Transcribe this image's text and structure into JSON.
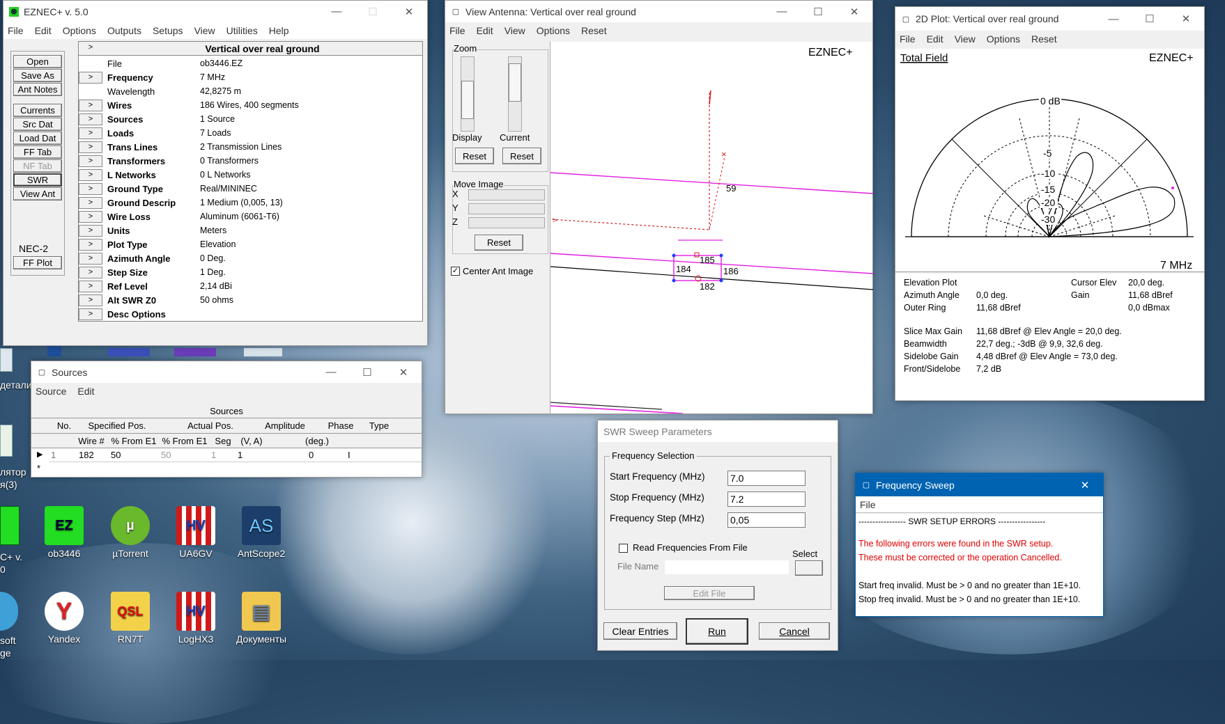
{
  "colors": {
    "magenta": "#e020e0",
    "red": "#d02020",
    "blue": "#1a3fff",
    "title_blue": "#0063b1",
    "error_red": "#e00000"
  },
  "main": {
    "title": "EZNEC+  v. 5.0",
    "menu": [
      "File",
      "Edit",
      "Options",
      "Outputs",
      "Setups",
      "View",
      "Utilities",
      "Help"
    ],
    "buttons": [
      "Open",
      "Save As",
      "Ant Notes",
      "Currents",
      "Src Dat",
      "Load Dat",
      "FF Tab",
      "NF Tab",
      "SWR",
      "View Ant"
    ],
    "nec_label": "NEC-2",
    "ffplot": "FF Plot",
    "arrow": ">",
    "header": "Vertical over real ground",
    "rows": [
      {
        "k": "File",
        "v": "ob3446.EZ",
        "bold": false,
        "arrow": false
      },
      {
        "k": "Frequency",
        "v": "7 MHz",
        "bold": true,
        "arrow": true
      },
      {
        "k": "Wavelength",
        "v": "42,8275 m",
        "bold": false,
        "arrow": false
      },
      {
        "k": "Wires",
        "v": "186 Wires, 400 segments",
        "bold": true,
        "arrow": true
      },
      {
        "k": "Sources",
        "v": "1 Source",
        "bold": true,
        "arrow": true
      },
      {
        "k": "Loads",
        "v": "7 Loads",
        "bold": true,
        "arrow": true
      },
      {
        "k": "Trans Lines",
        "v": "2 Transmission Lines",
        "bold": true,
        "arrow": true
      },
      {
        "k": "Transformers",
        "v": "0 Transformers",
        "bold": true,
        "arrow": true
      },
      {
        "k": "L Networks",
        "v": "0 L Networks",
        "bold": true,
        "arrow": true
      },
      {
        "k": "Ground Type",
        "v": "Real/MININEC",
        "bold": true,
        "arrow": true
      },
      {
        "k": "Ground Descrip",
        "v": "1 Medium (0,005, 13)",
        "bold": true,
        "arrow": true
      },
      {
        "k": "Wire Loss",
        "v": "Aluminum (6061-T6)",
        "bold": true,
        "arrow": true
      },
      {
        "k": "Units",
        "v": "Meters",
        "bold": true,
        "arrow": true
      },
      {
        "k": "Plot Type",
        "v": "Elevation",
        "bold": true,
        "arrow": true
      },
      {
        "k": "Azimuth Angle",
        "v": "0 Deg.",
        "bold": true,
        "arrow": true
      },
      {
        "k": "Step Size",
        "v": "1 Deg.",
        "bold": true,
        "arrow": true
      },
      {
        "k": "Ref Level",
        "v": "2,14 dBi",
        "bold": true,
        "arrow": true
      },
      {
        "k": "Alt SWR Z0",
        "v": "50 ohms",
        "bold": true,
        "arrow": true
      },
      {
        "k": "Desc Options",
        "v": "",
        "bold": true,
        "arrow": true
      }
    ]
  },
  "view": {
    "title": "View Antenna: Vertical over real ground",
    "menu": [
      "File",
      "Edit",
      "View",
      "Options",
      "Reset"
    ],
    "zoom": "Zoom",
    "display": "Display",
    "current": "Current",
    "reset": "Reset",
    "move": "Move Image",
    "x": "X",
    "y": "Y",
    "z": "Z",
    "center": "Center Ant Image",
    "brand": "EZNEC+",
    "labels": {
      "w59": "59",
      "w185": "185",
      "w184": "184",
      "w186": "186",
      "w182": "182"
    }
  },
  "plot": {
    "title": "2D Plot: Vertical over real ground",
    "menu": [
      "File",
      "Edit",
      "View",
      "Options",
      "Reset"
    ],
    "total": "Total Field",
    "brand": "EZNEC+",
    "freq": "7 MHz",
    "rings": [
      "0 dB",
      "-5",
      "-10",
      "-15",
      "-20",
      "-30"
    ],
    "info": [
      [
        "Elevation Plot",
        "",
        "Cursor Elev",
        "20,0 deg."
      ],
      [
        "Azimuth Angle",
        "0,0 deg.",
        "Gain",
        "11,68 dBref"
      ],
      [
        "Outer Ring",
        "11,68 dBref",
        "",
        "0,0 dBmax"
      ]
    ],
    "stats": [
      [
        "Slice Max Gain",
        "11,68 dBref @ Elev Angle = 20,0 deg."
      ],
      [
        "Beamwidth",
        "22,7 deg.; -3dB @ 9,9, 32,6 deg."
      ],
      [
        "Sidelobe Gain",
        "4,48 dBref @ Elev Angle = 73,0 deg."
      ],
      [
        "Front/Sidelobe",
        "7,2 dB"
      ]
    ]
  },
  "sources": {
    "title": "Sources",
    "menu": [
      "Source",
      "Edit"
    ],
    "group": "Sources",
    "h1": [
      "No.",
      "Specified Pos.",
      "Actual Pos.",
      "Amplitude",
      "Phase",
      "Type"
    ],
    "h2": [
      "Wire #",
      "% From E1",
      "% From E1",
      "Seg",
      "(V, A)",
      "(deg.)"
    ],
    "row": [
      "1",
      "182",
      "50",
      "50",
      "1",
      "1",
      "0",
      "I"
    ],
    "star": "*",
    "sel": "▶"
  },
  "swr": {
    "title": "SWR Sweep Parameters",
    "group": "Frequency Selection",
    "start_label": "Start Frequency (MHz)",
    "start": "7.0",
    "stop_label": "Stop Frequency (MHz)",
    "stop": "7.2",
    "step_label": "Frequency Step (MHz)",
    "step": "0,05",
    "read": "Read Frequencies From File",
    "select": "Select",
    "file_name": "File Name",
    "edit_file": "Edit File",
    "clear": "Clear Entries",
    "run": "Run",
    "cancel": "Cancel"
  },
  "freq": {
    "title": "Frequency Sweep",
    "menu": "File",
    "lines": [
      "----------------- SWR SETUP ERRORS -----------------",
      "The following errors were found in the SWR setup.",
      "These must be corrected or the operation Cancelled.",
      "",
      "Start freq invalid. Must be > 0 and no greater than 1E+10.",
      "Stop freq invalid. Must be > 0 and no greater than 1E+10."
    ]
  },
  "desktop": [
    {
      "label": "ob3446",
      "glyph": "EZ",
      "color": "#22dd22"
    },
    {
      "label": "µTorrent",
      "glyph": "µ",
      "color": "#6ab82c"
    },
    {
      "label": "UA6GV",
      "glyph": "HV",
      "color": "#d6d6ff"
    },
    {
      "label": "AntScope2",
      "glyph": "AS",
      "color": "#1d3e6a"
    },
    {
      "label": "Yandex",
      "glyph": "Y",
      "color": "#ffffff"
    },
    {
      "label": "RN7T",
      "glyph": "QSL",
      "color": "#f3d24a"
    },
    {
      "label": "LogHX3",
      "glyph": "HV",
      "color": "#d6d6ff"
    },
    {
      "label": "Документы",
      "glyph": "▤",
      "color": "#f0c850"
    }
  ],
  "desktop_edge": {
    "l1": "детали",
    "l2": "лятор",
    "l3": "я(3)",
    "l4": "C+ v.",
    "l5": "0",
    "l6": "soft",
    "l7": "ge"
  }
}
